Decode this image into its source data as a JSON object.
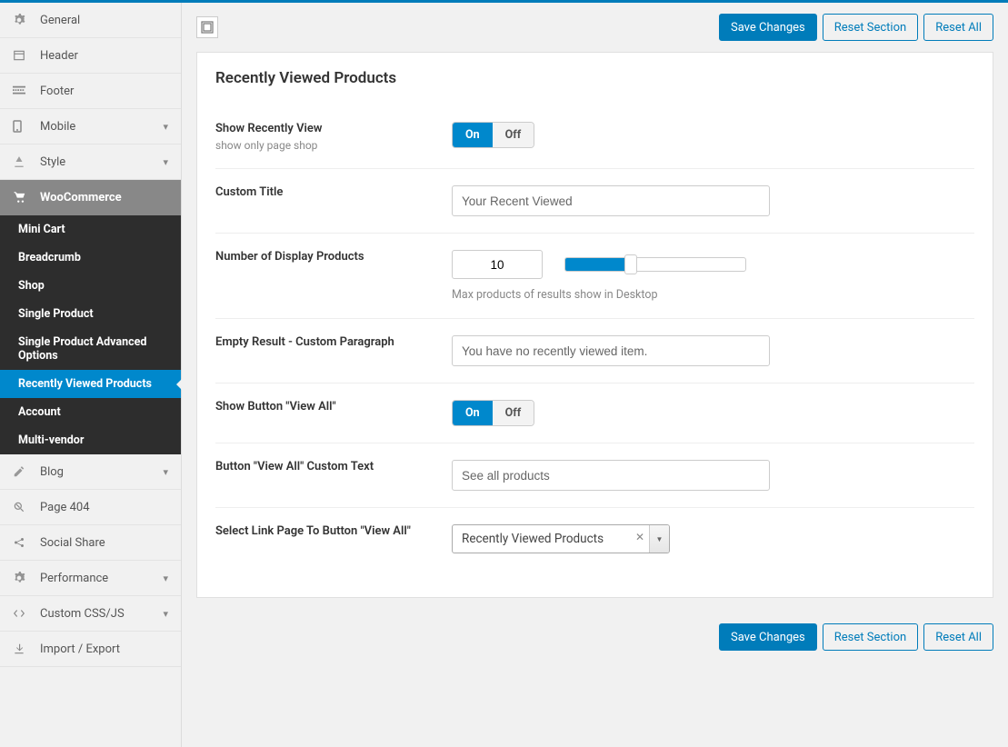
{
  "sidebar": {
    "items": [
      {
        "icon": "gear",
        "label": "General"
      },
      {
        "icon": "header",
        "label": "Header"
      },
      {
        "icon": "footer",
        "label": "Footer"
      },
      {
        "icon": "mobile",
        "label": "Mobile",
        "expandable": true
      },
      {
        "icon": "style",
        "label": "Style",
        "expandable": true
      },
      {
        "icon": "woo",
        "label": "WooCommerce",
        "active": true,
        "children": [
          {
            "label": "Mini Cart"
          },
          {
            "label": "Breadcrumb"
          },
          {
            "label": "Shop"
          },
          {
            "label": "Single Product"
          },
          {
            "label": "Single Product Advanced Options"
          },
          {
            "label": "Recently Viewed Products",
            "active": true
          },
          {
            "label": "Account"
          },
          {
            "label": "Multi-vendor"
          }
        ]
      },
      {
        "icon": "blog",
        "label": "Blog",
        "expandable": true
      },
      {
        "icon": "404",
        "label": "Page 404"
      },
      {
        "icon": "share",
        "label": "Social Share"
      },
      {
        "icon": "gear",
        "label": "Performance",
        "expandable": true
      },
      {
        "icon": "code",
        "label": "Custom CSS/JS",
        "expandable": true
      },
      {
        "icon": "import",
        "label": "Import / Export"
      }
    ]
  },
  "buttons": {
    "save": "Save Changes",
    "reset_section": "Reset Section",
    "reset_all": "Reset All"
  },
  "panel": {
    "title": "Recently Viewed Products",
    "fields": {
      "show_recent": {
        "label": "Show Recently View",
        "sub": "show only page shop",
        "on": "On",
        "off": "Off"
      },
      "custom_title": {
        "label": "Custom Title",
        "value": "Your Recent Viewed"
      },
      "num_display": {
        "label": "Number of Display Products",
        "value": "10",
        "help": "Max products of results show in Desktop"
      },
      "empty_result": {
        "label": "Empty Result - Custom Paragraph",
        "value": "You have no recently viewed item."
      },
      "show_viewall": {
        "label": "Show Button \"View All\"",
        "on": "On",
        "off": "Off"
      },
      "viewall_text": {
        "label": "Button \"View All\" Custom Text",
        "value": "See all products"
      },
      "viewall_link": {
        "label": "Select Link Page To Button \"View All\"",
        "selected": "Recently Viewed Products"
      }
    }
  }
}
